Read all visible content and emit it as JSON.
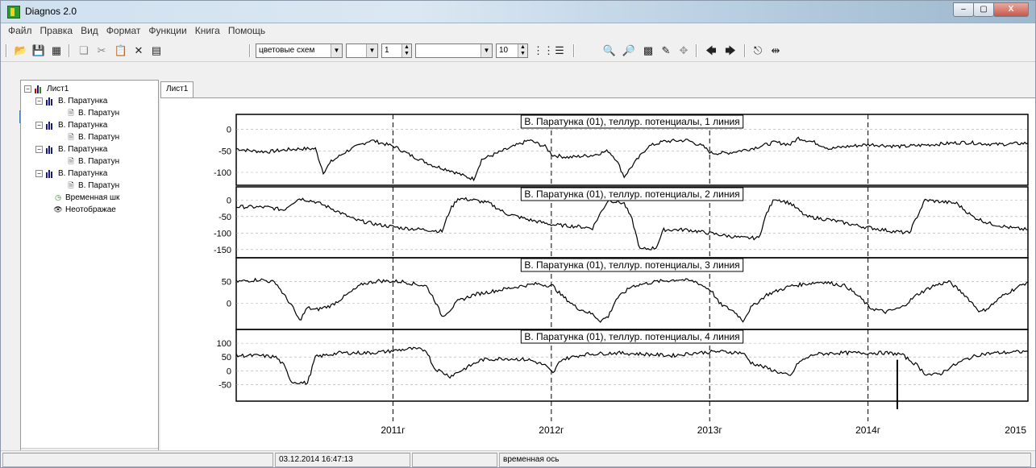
{
  "window": {
    "title": "Diagnos 2.0",
    "min": "‒",
    "max": "▢",
    "close": "X"
  },
  "menu": [
    "Файл",
    "Правка",
    "Вид",
    "Формат",
    "Функции",
    "Книга",
    "Помощь"
  ],
  "toolbar": {
    "color_scheme": "цветовые схем",
    "field1": "",
    "field2": "1",
    "field3": "",
    "field4": "10"
  },
  "tree": {
    "root": "Лист1",
    "series": [
      {
        "name": "В. Паратунка",
        "child": "В. Паратун"
      },
      {
        "name": "В. Паратунка",
        "child": "В. Паратун"
      },
      {
        "name": "В. Паратунка",
        "child": "В. Паратун"
      },
      {
        "name": "В. Паратунка",
        "child": "В. Паратун"
      }
    ],
    "time_scale": "Временная шк",
    "hidden": "Неотображае"
  },
  "tab": {
    "label": "Лист1"
  },
  "chart_data": {
    "type": "line",
    "x_axis": {
      "ticks": [
        "2011г",
        "2012г",
        "2013г",
        "2014г",
        "2015"
      ],
      "range": [
        "2010-03",
        "2015-01"
      ]
    },
    "panels": [
      {
        "title": "В. Паратунка (01), теллур. потенциалы, 1 линия",
        "yticks": [
          "0",
          "-50",
          "-100"
        ],
        "ylim": [
          -130,
          35
        ],
        "points": [
          [
            0,
            -45
          ],
          [
            2,
            -50
          ],
          [
            4,
            -52
          ],
          [
            6,
            -48
          ],
          [
            8,
            -45
          ],
          [
            10,
            -45
          ],
          [
            11,
            -100
          ],
          [
            12,
            -75
          ],
          [
            14,
            -50
          ],
          [
            17,
            -25
          ],
          [
            20,
            -40
          ],
          [
            22,
            -60
          ],
          [
            25,
            -85
          ],
          [
            27,
            -95
          ],
          [
            29,
            -110
          ],
          [
            30,
            -115
          ],
          [
            31,
            -70
          ],
          [
            33,
            -55
          ],
          [
            35,
            -40
          ],
          [
            37,
            -25
          ],
          [
            39,
            -40
          ],
          [
            40,
            -60
          ],
          [
            42,
            -65
          ],
          [
            45,
            -60
          ],
          [
            47,
            -50
          ],
          [
            48,
            -70
          ],
          [
            49,
            -110
          ],
          [
            50,
            -85
          ],
          [
            52,
            -40
          ],
          [
            54,
            -28
          ],
          [
            57,
            -25
          ],
          [
            59,
            -40
          ],
          [
            60,
            -55
          ],
          [
            62,
            -55
          ],
          [
            65,
            -45
          ],
          [
            68,
            -30
          ],
          [
            70,
            -35
          ],
          [
            71,
            -20
          ],
          [
            73,
            -30
          ],
          [
            75,
            -45
          ],
          [
            77,
            -40
          ],
          [
            80,
            -35
          ],
          [
            84,
            -40
          ],
          [
            88,
            -35
          ],
          [
            92,
            -30
          ],
          [
            96,
            -35
          ],
          [
            100,
            -32
          ]
        ]
      },
      {
        "title": "В. Паратунка (01), теллур. потенциалы, 2 линия",
        "yticks": [
          "0",
          "-50",
          "-100",
          "-150"
        ],
        "ylim": [
          -175,
          40
        ],
        "points": [
          [
            0,
            -20
          ],
          [
            4,
            -22
          ],
          [
            6,
            -30
          ],
          [
            7,
            -10
          ],
          [
            8,
            5
          ],
          [
            10,
            -5
          ],
          [
            12,
            -25
          ],
          [
            15,
            -60
          ],
          [
            18,
            -75
          ],
          [
            21,
            -85
          ],
          [
            24,
            -90
          ],
          [
            26,
            -95
          ],
          [
            27,
            -30
          ],
          [
            28,
            5
          ],
          [
            30,
            0
          ],
          [
            32,
            -10
          ],
          [
            34,
            -40
          ],
          [
            37,
            -60
          ],
          [
            40,
            -75
          ],
          [
            43,
            -80
          ],
          [
            45,
            -85
          ],
          [
            46,
            -40
          ],
          [
            47,
            0
          ],
          [
            49,
            -10
          ],
          [
            50,
            -60
          ],
          [
            51,
            -150
          ],
          [
            53,
            -145
          ],
          [
            54,
            -90
          ],
          [
            57,
            -90
          ],
          [
            61,
            -105
          ],
          [
            64,
            -115
          ],
          [
            66,
            -115
          ],
          [
            67,
            -40
          ],
          [
            68,
            5
          ],
          [
            70,
            -10
          ],
          [
            72,
            -50
          ],
          [
            75,
            -60
          ],
          [
            79,
            -80
          ],
          [
            83,
            -95
          ],
          [
            85,
            -100
          ],
          [
            86,
            -50
          ],
          [
            87,
            0
          ],
          [
            89,
            -5
          ],
          [
            91,
            -10
          ],
          [
            93,
            -50
          ],
          [
            95,
            -70
          ],
          [
            98,
            -85
          ],
          [
            100,
            -90
          ]
        ]
      },
      {
        "title": "В. Паратунка (01), теллур. потенциалы, 3 линия",
        "yticks": [
          "50",
          "0"
        ],
        "ylim": [
          -60,
          105
        ],
        "points": [
          [
            0,
            50
          ],
          [
            3,
            55
          ],
          [
            5,
            48
          ],
          [
            6,
            20
          ],
          [
            7,
            -5
          ],
          [
            8,
            -40
          ],
          [
            9,
            -10
          ],
          [
            10,
            -15
          ],
          [
            12,
            -5
          ],
          [
            14,
            20
          ],
          [
            16,
            45
          ],
          [
            18,
            52
          ],
          [
            21,
            50
          ],
          [
            24,
            40
          ],
          [
            25,
            10
          ],
          [
            26,
            -30
          ],
          [
            27,
            -15
          ],
          [
            28,
            5
          ],
          [
            30,
            20
          ],
          [
            33,
            30
          ],
          [
            36,
            40
          ],
          [
            38,
            45
          ],
          [
            40,
            40
          ],
          [
            41,
            20
          ],
          [
            43,
            -10
          ],
          [
            45,
            -25
          ],
          [
            46,
            -40
          ],
          [
            47,
            -30
          ],
          [
            48,
            10
          ],
          [
            50,
            40
          ],
          [
            53,
            50
          ],
          [
            56,
            55
          ],
          [
            58,
            50
          ],
          [
            60,
            30
          ],
          [
            61,
            0
          ],
          [
            63,
            -20
          ],
          [
            64,
            -40
          ],
          [
            65,
            -10
          ],
          [
            67,
            20
          ],
          [
            70,
            40
          ],
          [
            74,
            50
          ],
          [
            77,
            40
          ],
          [
            79,
            10
          ],
          [
            80,
            -10
          ],
          [
            82,
            -20
          ],
          [
            84,
            -10
          ],
          [
            86,
            20
          ],
          [
            88,
            40
          ],
          [
            90,
            50
          ],
          [
            92,
            20
          ],
          [
            94,
            -20
          ],
          [
            95,
            -10
          ],
          [
            97,
            20
          ],
          [
            100,
            50
          ]
        ]
      },
      {
        "title": "В. Паратунка (01), теллур. потенциалы, 4 линия",
        "yticks": [
          "100",
          "50",
          "0",
          "-50"
        ],
        "ylim": [
          -110,
          150
        ],
        "points": [
          [
            0,
            55
          ],
          [
            3,
            55
          ],
          [
            5,
            50
          ],
          [
            6,
            20
          ],
          [
            7,
            -40
          ],
          [
            9,
            -45
          ],
          [
            10,
            50
          ],
          [
            13,
            65
          ],
          [
            17,
            65
          ],
          [
            19,
            70
          ],
          [
            22,
            80
          ],
          [
            24,
            75
          ],
          [
            25,
            10
          ],
          [
            27,
            -20
          ],
          [
            29,
            10
          ],
          [
            31,
            40
          ],
          [
            34,
            45
          ],
          [
            37,
            40
          ],
          [
            39,
            20
          ],
          [
            40,
            -10
          ],
          [
            41,
            40
          ],
          [
            44,
            60
          ],
          [
            48,
            65
          ],
          [
            52,
            60
          ],
          [
            55,
            55
          ],
          [
            58,
            65
          ],
          [
            61,
            70
          ],
          [
            64,
            65
          ],
          [
            65,
            30
          ],
          [
            67,
            10
          ],
          [
            69,
            -10
          ],
          [
            70,
            -20
          ],
          [
            71,
            30
          ],
          [
            73,
            60
          ],
          [
            76,
            65
          ],
          [
            79,
            65
          ],
          [
            82,
            65
          ],
          [
            84,
            60
          ],
          [
            85,
            40
          ],
          [
            86,
            20
          ],
          [
            87,
            -10
          ],
          [
            88,
            -15
          ],
          [
            89,
            -10
          ],
          [
            90,
            10
          ],
          [
            92,
            40
          ],
          [
            94,
            60
          ],
          [
            96,
            65
          ],
          [
            100,
            70
          ]
        ],
        "spike": {
          "x": 83.5,
          "y": -100
        }
      }
    ]
  },
  "status": {
    "datetime": "03.12.2014 16:47:13",
    "axis": "временная ось"
  }
}
